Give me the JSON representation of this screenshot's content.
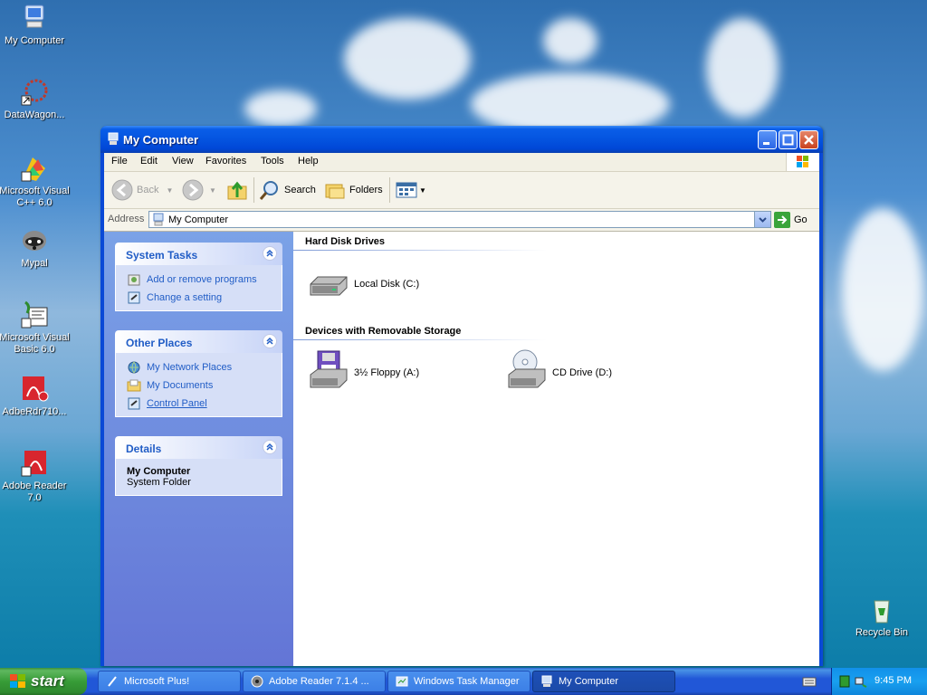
{
  "desktop": {
    "icons": [
      {
        "label": "My Computer"
      },
      {
        "label": "DataWagon..."
      },
      {
        "label": "Microsoft Visual C++ 6.0"
      },
      {
        "label": "Mypal"
      },
      {
        "label": "Microsoft Visual Basic 6.0"
      },
      {
        "label": "AdbeRdr710..."
      },
      {
        "label": "Adobe Reader 7.0"
      },
      {
        "label": "Recycle Bin"
      }
    ]
  },
  "window": {
    "title": "My Computer",
    "menu": [
      "File",
      "Edit",
      "View",
      "Favorites",
      "Tools",
      "Help"
    ],
    "toolbar": {
      "back": "Back",
      "search": "Search",
      "folders": "Folders"
    },
    "address": {
      "label": "Address",
      "value": "My Computer",
      "go": "Go"
    },
    "tasks": {
      "system": {
        "title": "System Tasks",
        "links": [
          "Add or remove programs",
          "Change a setting"
        ]
      },
      "other": {
        "title": "Other Places",
        "links": [
          "My Network Places",
          "My Documents",
          "Control Panel"
        ]
      },
      "details": {
        "title": "Details",
        "name": "My Computer",
        "type": "System Folder"
      }
    },
    "groups": {
      "hdd": {
        "title": "Hard Disk Drives",
        "items": [
          "Local Disk (C:)"
        ]
      },
      "removable": {
        "title": "Devices with Removable Storage",
        "items": [
          "3½ Floppy (A:)",
          "CD Drive (D:)"
        ]
      }
    }
  },
  "taskbar": {
    "start": "start",
    "tasks": [
      "Microsoft Plus!",
      "Adobe Reader 7.1.4 ...",
      "Windows Task Manager",
      "My Computer"
    ],
    "clock": "9:45 PM"
  },
  "colors": {
    "titlebar": "#0454e0",
    "taskpane_link": "#215dc6",
    "start_green": "#379c37"
  }
}
